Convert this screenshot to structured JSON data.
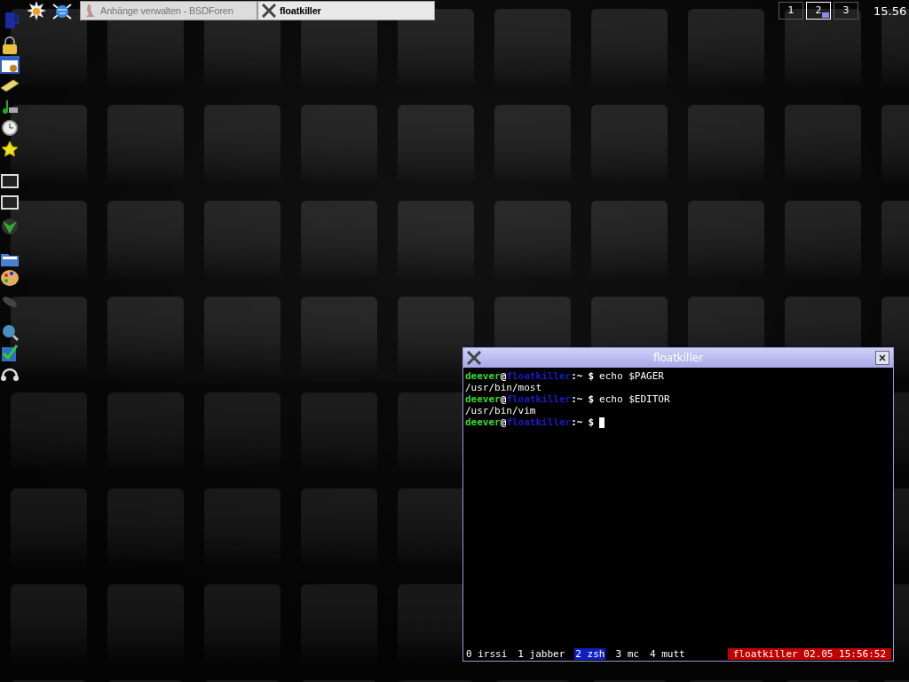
{
  "tasks": [
    {
      "title": "Anhänge verwalten - BSDForen",
      "selected": false
    },
    {
      "title": "floatkiller",
      "selected": true
    }
  ],
  "workspaces": [
    {
      "label": "1",
      "selected": false
    },
    {
      "label": "2",
      "selected": true
    },
    {
      "label": "3",
      "selected": false
    }
  ],
  "clock": "15.56",
  "terminal": {
    "title": "floatkiller",
    "lines": [
      {
        "kind": "prompt",
        "user": "deever",
        "at": "@",
        "host": "floatkiller",
        "separator": ":~",
        "symbol": "$",
        "command": "echo $PAGER",
        "cursor": false
      },
      {
        "kind": "output",
        "text": "/usr/bin/most"
      },
      {
        "kind": "prompt",
        "user": "deever",
        "at": "@",
        "host": "floatkiller",
        "separator": ":~",
        "symbol": "$",
        "command": "echo $EDITOR",
        "cursor": false
      },
      {
        "kind": "output",
        "text": "/usr/bin/vim"
      },
      {
        "kind": "prompt",
        "user": "deever",
        "at": "@",
        "host": "floatkiller",
        "separator": ":~",
        "symbol": "$",
        "cursor": true
      }
    ],
    "screen_windows": [
      {
        "label": "0 irssi",
        "selected": false
      },
      {
        "label": "1 jabber",
        "selected": false
      },
      {
        "label": "2 zsh",
        "selected": true
      },
      {
        "label": "3 mc",
        "selected": false
      },
      {
        "label": "4 mutt",
        "selected": false
      }
    ],
    "status": "floatkiller 02.05 15:56:52"
  }
}
